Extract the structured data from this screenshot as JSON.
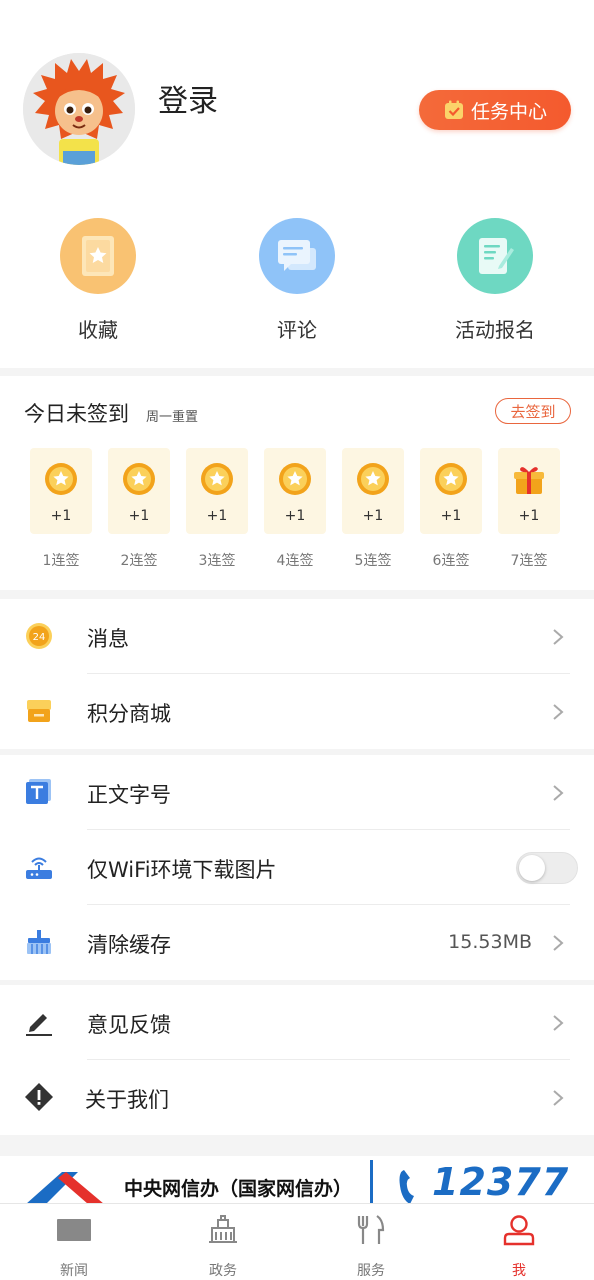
{
  "profile": {
    "login_label": "登录",
    "task_center_label": "任务中心"
  },
  "quick_actions": [
    {
      "label": "收藏",
      "icon": "bookmark-icon",
      "color": "#f9c272"
    },
    {
      "label": "评论",
      "icon": "comment-icon",
      "color": "#8fc3f8"
    },
    {
      "label": "活动报名",
      "icon": "signup-form-icon",
      "color": "#6ed8c2"
    }
  ],
  "signin": {
    "title": "今日未签到",
    "subtitle": "周一重置",
    "button_label": "去签到",
    "days": [
      {
        "reward": "+1",
        "label": "1连签",
        "icon": "coin-icon"
      },
      {
        "reward": "+1",
        "label": "2连签",
        "icon": "coin-icon"
      },
      {
        "reward": "+1",
        "label": "3连签",
        "icon": "coin-icon"
      },
      {
        "reward": "+1",
        "label": "4连签",
        "icon": "coin-icon"
      },
      {
        "reward": "+1",
        "label": "5连签",
        "icon": "coin-icon"
      },
      {
        "reward": "+1",
        "label": "6连签",
        "icon": "coin-icon"
      },
      {
        "reward": "+1",
        "label": "7连签",
        "icon": "gift-icon"
      }
    ]
  },
  "menu": {
    "messages": {
      "label": "消息",
      "badge": "24"
    },
    "points_mall": {
      "label": "积分商城"
    },
    "font_size": {
      "label": "正文字号"
    },
    "wifi_only_images": {
      "label": "仅WiFi环境下载图片",
      "enabled": false
    },
    "clear_cache": {
      "label": "清除缓存",
      "value": "15.53MB"
    },
    "feedback": {
      "label": "意见反馈"
    },
    "about": {
      "label": "关于我们"
    }
  },
  "banner": {
    "text": "中央网信办（国家网信办）",
    "hotline": "12377"
  },
  "tabbar": [
    {
      "label": "新闻",
      "icon": "news-icon",
      "active": false
    },
    {
      "label": "政务",
      "icon": "government-building-icon",
      "active": false
    },
    {
      "label": "服务",
      "icon": "fork-knife-icon",
      "active": false
    },
    {
      "label": "我",
      "icon": "person-icon",
      "active": true
    }
  ],
  "colors": {
    "accent": "#e5312c",
    "task_button": "#f45a2e",
    "signin_button": "#e9663e",
    "day_card": "#fdf6e2"
  }
}
